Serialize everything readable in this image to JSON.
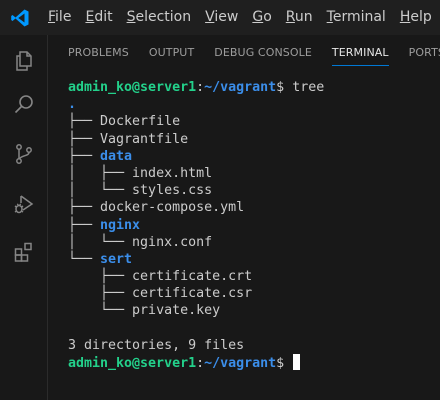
{
  "menu": {
    "items": [
      "File",
      "Edit",
      "Selection",
      "View",
      "Go",
      "Run",
      "Terminal",
      "Help"
    ],
    "mnemonic_index": [
      0,
      0,
      0,
      0,
      0,
      0,
      0,
      0
    ]
  },
  "activity_bar": {
    "icons": [
      "explorer-icon",
      "search-icon",
      "source-control-icon",
      "run-debug-icon",
      "extensions-icon"
    ]
  },
  "panel": {
    "tabs": [
      "PROBLEMS",
      "OUTPUT",
      "DEBUG CONSOLE",
      "TERMINAL",
      "PORTS"
    ],
    "active_tab": "TERMINAL"
  },
  "terminal": {
    "prompt_user": "admin_ko@server1",
    "prompt_sep": ":",
    "prompt_path": "~/vagrant",
    "prompt_end": "$ ",
    "command": "tree",
    "tree": [
      {
        "prefix": "",
        "name": ".",
        "is_dir": true
      },
      {
        "prefix": "├── ",
        "name": "Dockerfile",
        "is_dir": false
      },
      {
        "prefix": "├── ",
        "name": "Vagrantfile",
        "is_dir": false
      },
      {
        "prefix": "├── ",
        "name": "data",
        "is_dir": true
      },
      {
        "prefix": "│   ├── ",
        "name": "index.html",
        "is_dir": false
      },
      {
        "prefix": "│   └── ",
        "name": "styles.css",
        "is_dir": false
      },
      {
        "prefix": "├── ",
        "name": "docker-compose.yml",
        "is_dir": false
      },
      {
        "prefix": "├── ",
        "name": "nginx",
        "is_dir": true
      },
      {
        "prefix": "│   └── ",
        "name": "nginx.conf",
        "is_dir": false
      },
      {
        "prefix": "└── ",
        "name": "sert",
        "is_dir": true
      },
      {
        "prefix": "    ├── ",
        "name": "certificate.crt",
        "is_dir": false
      },
      {
        "prefix": "    ├── ",
        "name": "certificate.csr",
        "is_dir": false
      },
      {
        "prefix": "    └── ",
        "name": "private.key",
        "is_dir": false
      }
    ],
    "summary": "3 directories, 9 files"
  },
  "colors": {
    "prompt_user": "#23d18b",
    "prompt_path": "#3b8eea",
    "directory": "#3b8eea",
    "active_tab_underline": "#0078d4",
    "vscode_blue": "#0098ff"
  }
}
